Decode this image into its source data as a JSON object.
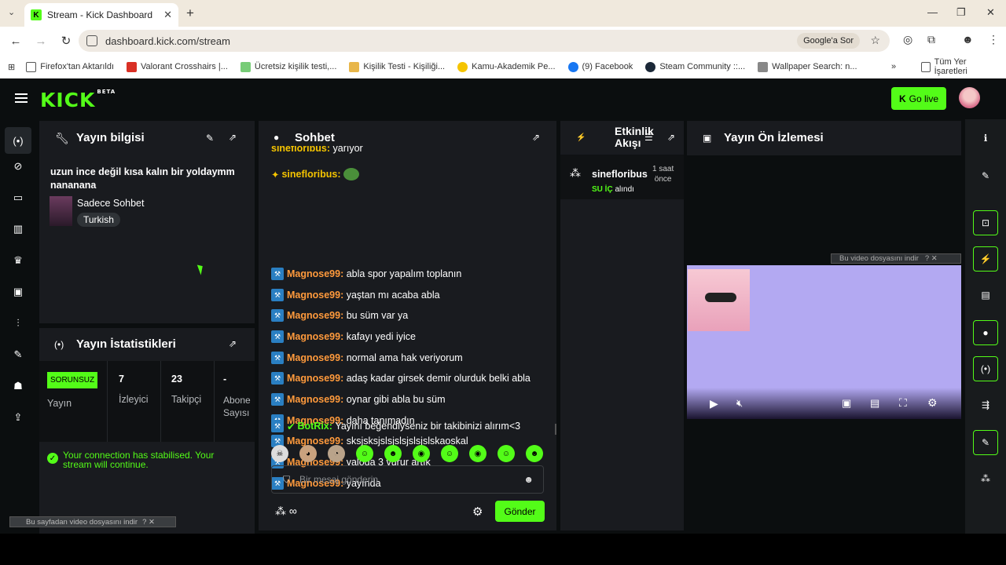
{
  "browser": {
    "tab_title": "Stream - Kick Dashboard",
    "url": "dashboard.kick.com/stream",
    "ask_google": "Google'a Sor",
    "bookmarks": [
      "Firefox'tan Aktarıldı",
      "Valorant Crosshairs |...",
      "Ücretsiz kişilik testi,...",
      "Kişilik Testi - Kişiliği...",
      "Kamu-Akademik Pe...",
      "(9) Facebook",
      "Steam Community ::...",
      "Wallpaper Search: n..."
    ],
    "all_bookmarks": "Tüm Yer İşaretleri"
  },
  "header": {
    "logo": "KICK",
    "logo_sup": "BETA",
    "go_live": "Go live"
  },
  "stream_info": {
    "title": "Yayın bilgisi",
    "stream_title": "uzun ince değil kısa kalın bir yoldaymm nananana",
    "category": "Sadece Sohbet",
    "language": "Turkish"
  },
  "stats": {
    "title": "Yayın İstatistikleri",
    "status": "SORUNSUZ",
    "status_label": "Yayın",
    "viewers": "7",
    "viewers_label": "İzleyici",
    "followers": "23",
    "followers_label": "Takipçi",
    "subs": "-",
    "subs_label": "Abone Sayısı",
    "notice": "Your connection has stabilised. Your stream will continue."
  },
  "chat": {
    "title": "Sohbet",
    "partial_top": {
      "user": "sinefloribus:",
      "text": "yarıyor"
    },
    "emote_msg_user": "sinefloribus:",
    "messages": [
      {
        "user": "Magnose99:",
        "text": "abla spor yapalım toplanın"
      },
      {
        "user": "Magnose99:",
        "text": "yaştan mı acaba abla"
      },
      {
        "user": "Magnose99:",
        "text": "bu süm var ya"
      },
      {
        "user": "Magnose99:",
        "text": "kafayı yedi iyice"
      },
      {
        "user": "Magnose99:",
        "text": "normal ama hak veriyorum"
      },
      {
        "user": "Magnose99:",
        "text": "adaş kadar girsek demir olurduk belki abla"
      },
      {
        "user": "Magnose99:",
        "text": "oynar gibi abla bu süm"
      },
      {
        "user": "Magnose99:",
        "text": "daha tanımadın"
      },
      {
        "user": "Magnose99:",
        "text": "sksjsksjslsjslsjslsjslskaoskal"
      },
      {
        "user": "Magnose99:",
        "text": "valoda 3 vurur artık"
      },
      {
        "user": "Magnose99:",
        "text": "yayında"
      }
    ],
    "bot": {
      "user": "BotRix:",
      "text": "Yayını beğendiyseniz bir takibinizi alırım<3"
    },
    "placeholder": "Bir mesaj gönderin",
    "points": "∞",
    "send": "Gönder"
  },
  "activity": {
    "title_line1": "Etkinlik",
    "title_line2": "Akışı",
    "user": "sinefloribus",
    "time_line1": "1 saat",
    "time_line2": "önce",
    "event_highlight": "SU İÇ",
    "event_rest": "alındı"
  },
  "preview": {
    "title": "Yayın Ön İzlemesi",
    "download_hint": "Bu video dosyasını indir",
    "page_download_hint": "Bu sayfadan video dosyasını indir"
  },
  "colors": {
    "accent": "#53fc18",
    "panel": "#191b1f",
    "username": "#ff9a3c",
    "video_bg": "#b3a9f2"
  }
}
